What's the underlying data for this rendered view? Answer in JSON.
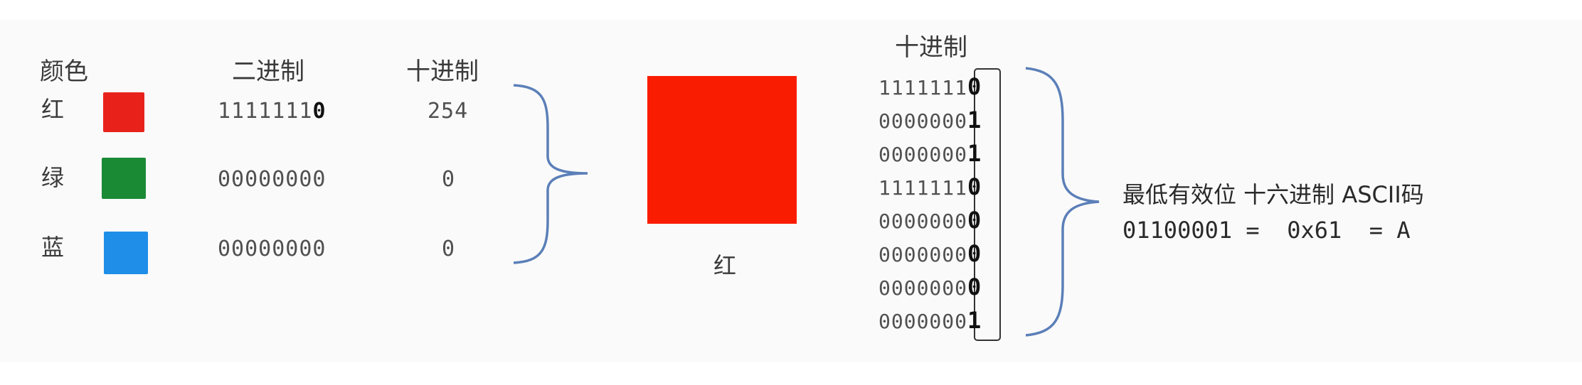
{
  "left_table": {
    "headers": {
      "color": "颜色",
      "binary": "二进制",
      "decimal": "十进制"
    },
    "rows": [
      {
        "name": "红",
        "swatch": "#e8221a",
        "binary_prefix": "1111111",
        "binary_lsb": "0",
        "decimal": "254"
      },
      {
        "name": "绿",
        "swatch": "#1a8a35",
        "binary_prefix": "00000000",
        "binary_lsb": "",
        "decimal": "0"
      },
      {
        "name": "蓝",
        "swatch": "#1e8ee8",
        "binary_prefix": "00000000",
        "binary_lsb": "",
        "decimal": "0"
      }
    ]
  },
  "pixel": {
    "color": "#fa1c00",
    "label": "红"
  },
  "bit_column": {
    "header": "十进制",
    "rows": [
      {
        "prefix": "1111111",
        "lsb": "0"
      },
      {
        "prefix": "0000000",
        "lsb": "1"
      },
      {
        "prefix": "0000000",
        "lsb": "1"
      },
      {
        "prefix": "1111111",
        "lsb": "0"
      },
      {
        "prefix": "0000000",
        "lsb": "0"
      },
      {
        "prefix": "0000000",
        "lsb": "0"
      },
      {
        "prefix": "0000000",
        "lsb": "0"
      },
      {
        "prefix": "0000000",
        "lsb": "1"
      }
    ]
  },
  "result": {
    "headings": "最低有效位 十六进制 ASCII码",
    "values": "01100001 =  0x61  = A"
  },
  "colors": {
    "brace": "#5b7fb8"
  }
}
